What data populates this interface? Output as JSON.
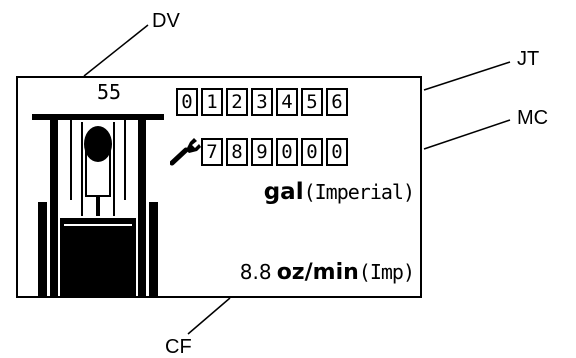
{
  "callouts": {
    "dv": "DV",
    "jt": "JT",
    "mc": "MC",
    "cf": "CF"
  },
  "display": {
    "dv_value": "55",
    "job_totalizer_digits": [
      "0",
      "1",
      "2",
      "3",
      "4",
      "5",
      "6"
    ],
    "maintenance_counter_digits": [
      "7",
      "8",
      "9",
      "0",
      "0",
      "0"
    ],
    "volume_unit": "gal",
    "volume_unit_qualifier": "(Imperial)",
    "flow_rate_value": "8.8",
    "flow_rate_unit": "oz/min",
    "flow_rate_qualifier": "(Imp)",
    "maintenance_icon": "wrench-icon"
  },
  "colors": {
    "ink": "#000000",
    "background": "#ffffff"
  }
}
